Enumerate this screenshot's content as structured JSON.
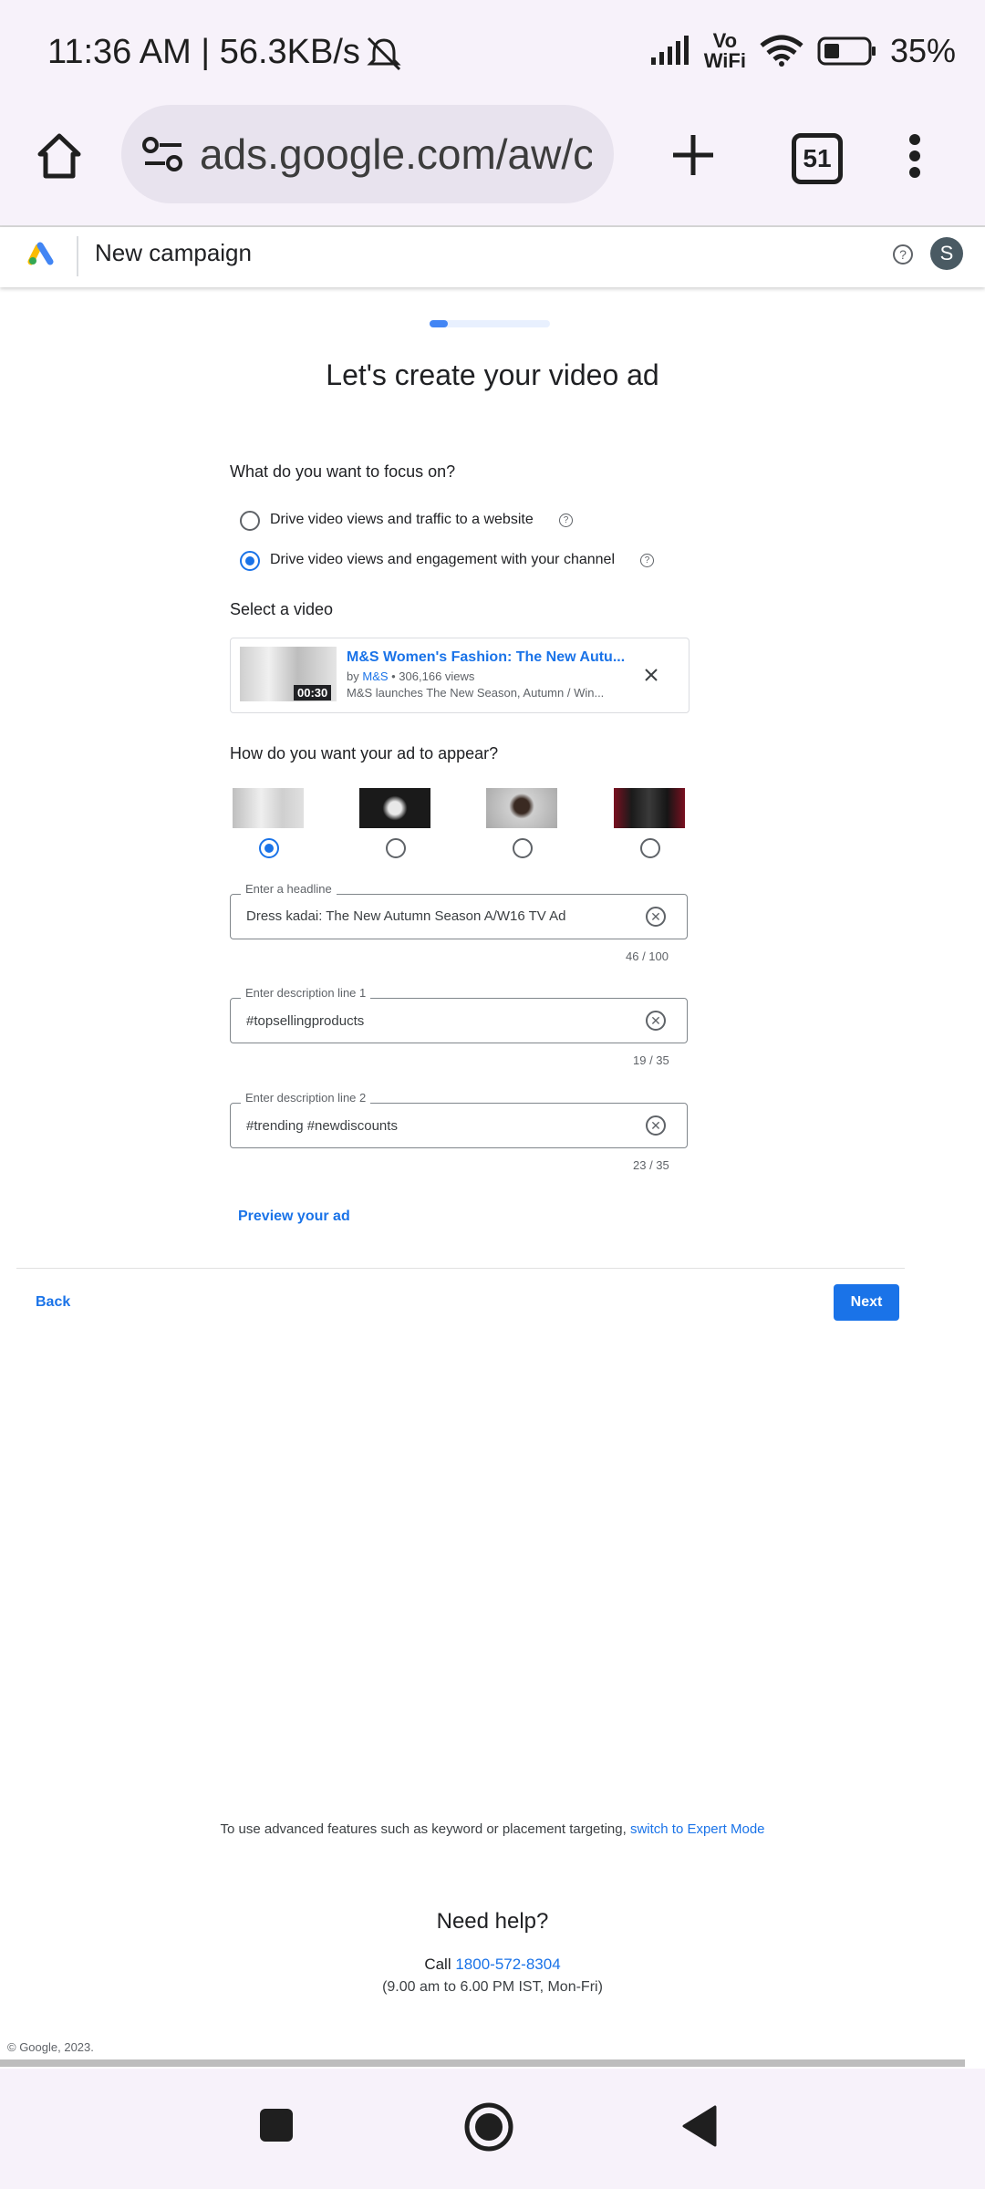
{
  "status_bar": {
    "time_speed": "11:36 AM | 56.3KB/s",
    "vowifi_line1": "Vo",
    "vowifi_line2": "WiFi",
    "battery": "35%"
  },
  "browser": {
    "url": "ads.google.com/aw/c",
    "tab_count": "51"
  },
  "header": {
    "title": "New campaign",
    "avatar_letter": "S"
  },
  "progress": {
    "fraction": 0.15
  },
  "page_title": "Let's create your video ad",
  "focus": {
    "label": "What do you want to focus on?",
    "options": [
      {
        "label": "Drive video views and traffic to a website",
        "selected": false
      },
      {
        "label": "Drive video views and engagement with your channel",
        "selected": true
      }
    ]
  },
  "video": {
    "section_label": "Select a video",
    "title": "M&S Women's Fashion: The New Autu...",
    "by": "by",
    "channel": "M&S",
    "views": " • 306,166 views",
    "description": "M&S launches The New Season, Autumn / Win...",
    "duration": "00:30"
  },
  "appearance": {
    "label": "How do you want your ad to appear?",
    "selected_index": 0
  },
  "fields": {
    "headline": {
      "label": "Enter a headline",
      "value": "Dress kadai: The New Autumn Season A/W16 TV Ad",
      "counter": "46 / 100"
    },
    "desc1": {
      "label": "Enter description line 1",
      "value": "#topsellingproducts",
      "counter": "19 / 35"
    },
    "desc2": {
      "label": "Enter description line 2",
      "value": "#trending #newdiscounts",
      "counter": "23 / 35"
    }
  },
  "preview_link": "Preview your ad",
  "nav": {
    "back": "Back",
    "next": "Next"
  },
  "footer": {
    "advanced_text": "To use advanced features such as keyword or placement targeting,",
    "expert_link": "switch to Expert Mode",
    "help_title": "Need help?",
    "call_prefix": "Call",
    "phone": "1800-572-8304",
    "hours": "(9.00 am to 6.00 PM IST, Mon-Fri)",
    "copyright": "© Google, 2023."
  },
  "colors": {
    "accent": "#1a73e8",
    "chrome_bg": "#f7f2fa"
  }
}
